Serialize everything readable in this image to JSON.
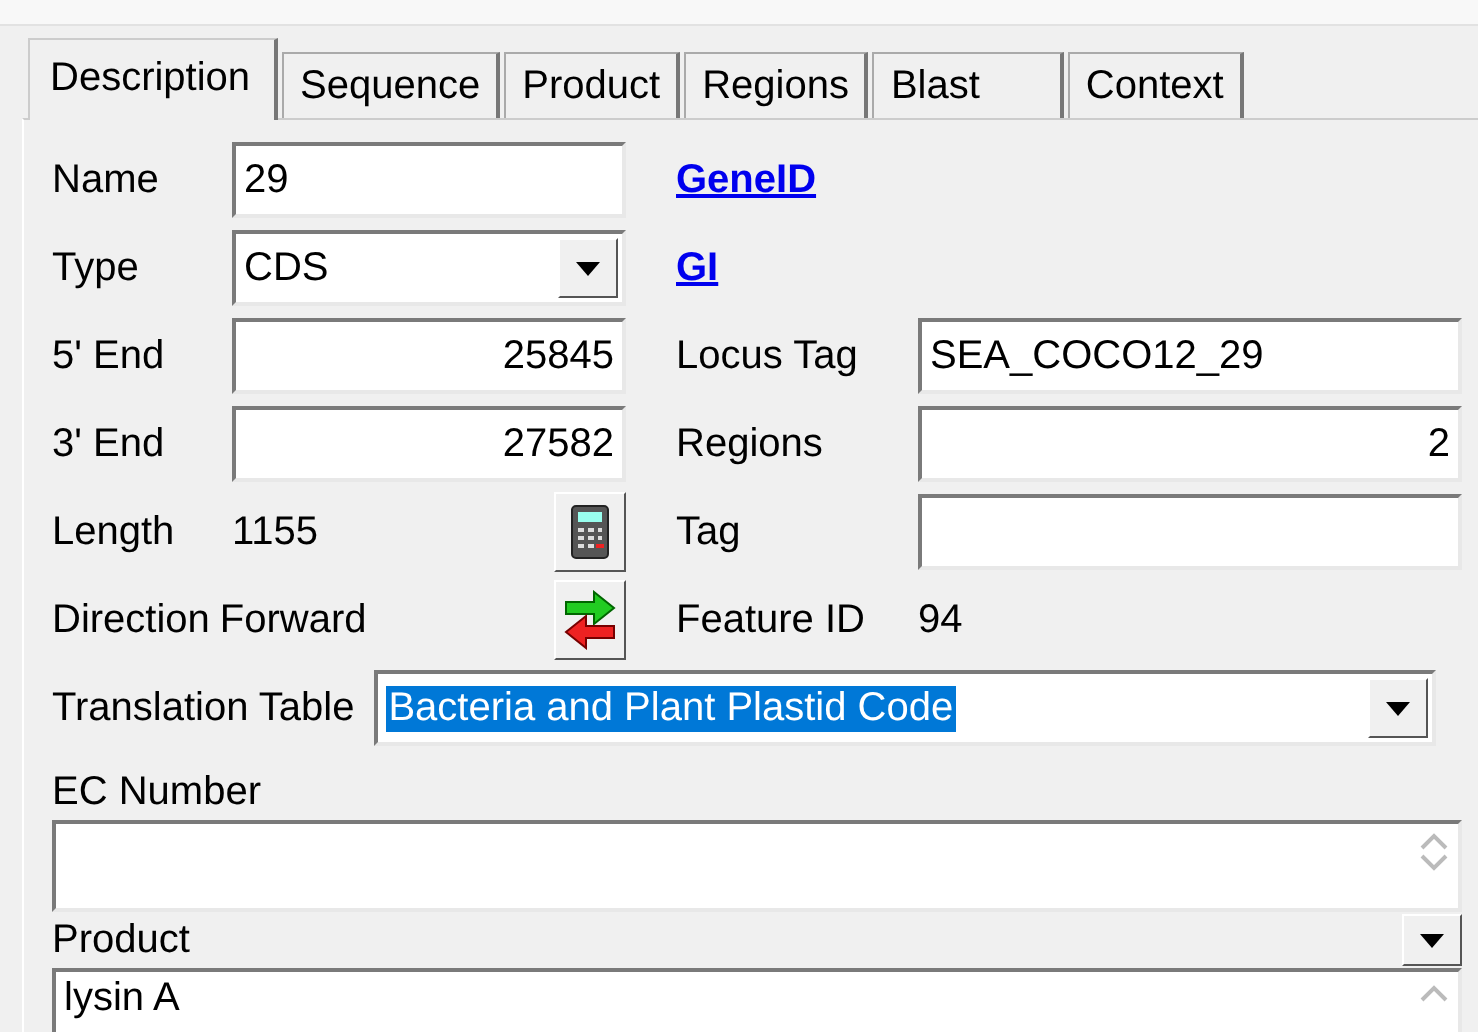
{
  "tabs": [
    {
      "label": "Description",
      "selected": true
    },
    {
      "label": "Sequence",
      "selected": false
    },
    {
      "label": "Product",
      "selected": false
    },
    {
      "label": "Regions",
      "selected": false
    },
    {
      "label": "Blast",
      "selected": false
    },
    {
      "label": "Context",
      "selected": false
    }
  ],
  "name_field": {
    "label": "Name",
    "value": "29"
  },
  "gene_id_link": "GeneID",
  "type_field": {
    "label": "Type",
    "value": "CDS"
  },
  "gi_link": "GI",
  "five_end": {
    "label": "5' End",
    "value": "25845"
  },
  "locus_tag": {
    "label": "Locus Tag",
    "value": "SEA_COCO12_29"
  },
  "three_end": {
    "label": "3' End",
    "value": "27582"
  },
  "regions": {
    "label": "Regions",
    "value": "2"
  },
  "length": {
    "label": "Length",
    "value": "1155"
  },
  "tag": {
    "label": "Tag"
  },
  "direction": {
    "label": "Direction",
    "value": "Forward"
  },
  "feature_id": {
    "label": "Feature ID",
    "value": "94"
  },
  "translation_table": {
    "label": "Translation Table",
    "value": "Bacteria and Plant Plastid Code",
    "selected": true
  },
  "ec_number": {
    "label": "EC Number"
  },
  "product": {
    "label": "Product",
    "value": "lysin A"
  }
}
